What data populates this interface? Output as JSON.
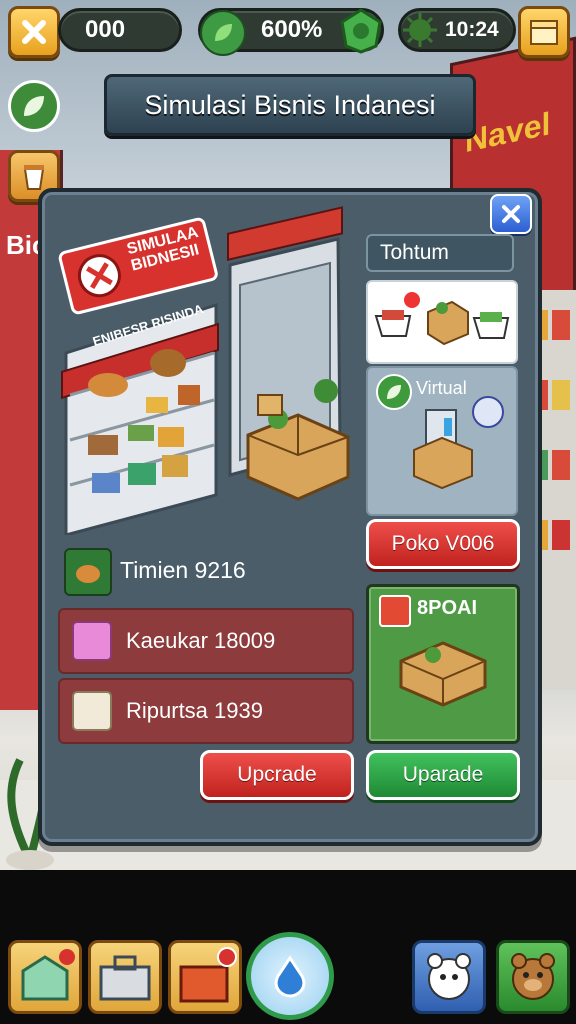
{
  "hud": {
    "coins": "000",
    "percent": "600%",
    "time": "10:24"
  },
  "title": "Simulasi Bisnis Indanesi",
  "panel": {
    "shop_sign_top": "SIMULAA BIDNESII",
    "shop_sign_bottom": "ENIBESR RISINDA",
    "tab_label": "Tohtum",
    "virtual_label": "Virtual",
    "red_action_label": "Poko V006",
    "green_card_label": "8POAI",
    "stat_label": "Timien 9216",
    "rows": [
      {
        "label": "Kaeukar 18009",
        "icon": "gift-box-icon"
      },
      {
        "label": "Ripurtsa 1939",
        "icon": "package-icon"
      }
    ],
    "upgrade_red": "Upcrade",
    "upgrade_green": "Uparade"
  },
  "background": {
    "left_wall_text": "Bic",
    "right_wall_text": "Navel"
  },
  "colors": {
    "panel": "#4a5d69",
    "red_button": "#d9332e",
    "green_button": "#2fa347",
    "gold": "#f5b83a"
  },
  "dock": {
    "items": [
      "greenhouse-icon",
      "toolbox-icon",
      "delivery-box-icon",
      "water-drop-icon",
      "polar-bear-icon",
      "bear-icon"
    ]
  }
}
